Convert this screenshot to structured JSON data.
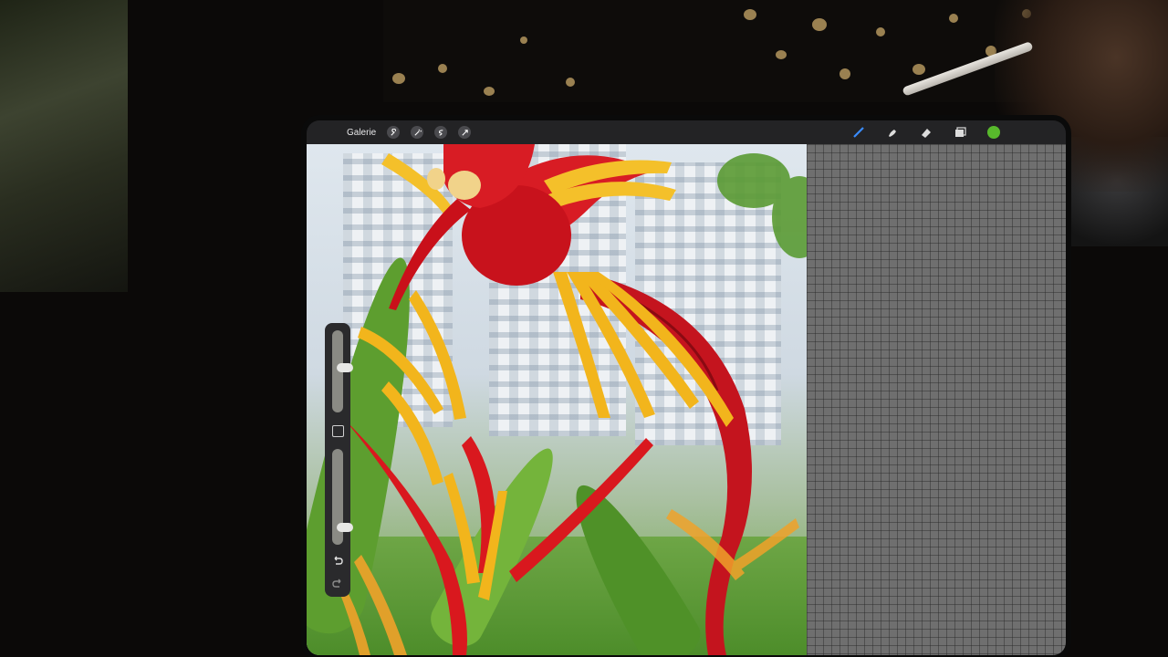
{
  "toolbar": {
    "gallery_label": "Galerie",
    "left_tools": [
      "wrench-icon",
      "magic-wand-icon",
      "selection-icon",
      "transform-icon"
    ],
    "right_tools": [
      "brush-icon",
      "smudge-icon",
      "eraser-icon",
      "layers-icon"
    ],
    "active_color": "#58b92c",
    "brush_color": "#3a8cff"
  },
  "sidebar": {
    "brush_size_level": 0.55,
    "opacity_level": 0.15
  }
}
